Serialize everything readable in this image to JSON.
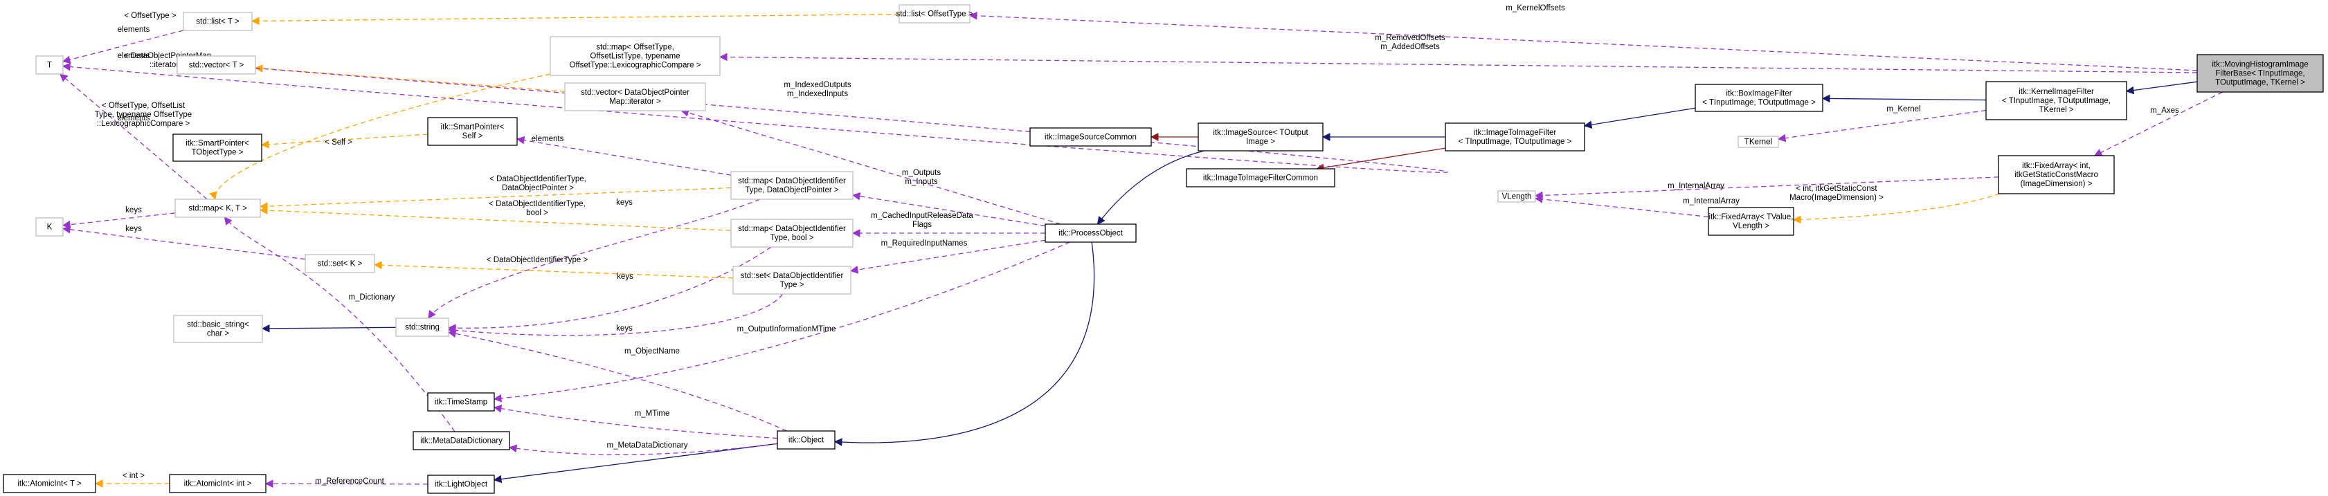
{
  "title": "itk::MovingHistogramImageFilterBase< TInputImage, TOutputImage, TKernel > collaboration diagram",
  "colors": {
    "inheritance": "#191970",
    "protected_inheritance": "#8b1a1a",
    "usage": "#9a32cd",
    "template_instance": "#ffa500",
    "focus_fill": "#bfbfbf"
  },
  "nodes": [
    {
      "id": "MovingHistogramImageFilterBase",
      "lines": [
        "itk::MovingHistogramImage",
        "FilterBase< TInputImage,",
        " TOutputImage, TKernel >"
      ],
      "style": "focus"
    },
    {
      "id": "KernelImageFilter",
      "lines": [
        "itk::KernelImageFilter",
        "< TInputImage, TOutputImage,",
        "TKernel >"
      ],
      "style": "doc"
    },
    {
      "id": "BoxImageFilter",
      "lines": [
        "itk::BoxImageFilter",
        "< TInputImage, TOutputImage >"
      ],
      "style": "doc"
    },
    {
      "id": "ImageToImageFilter",
      "lines": [
        "itk::ImageToImageFilter",
        "< TInputImage, TOutputImage >"
      ],
      "style": "doc"
    },
    {
      "id": "ImageSource",
      "lines": [
        "itk::ImageSource< TOutput",
        "Image >"
      ],
      "style": "doc"
    },
    {
      "id": "ImageSourceCommon",
      "lines": [
        "itk::ImageSourceCommon"
      ],
      "style": "doc"
    },
    {
      "id": "ImageToImageFilterCommon",
      "lines": [
        "itk::ImageToImageFilterCommon"
      ],
      "style": "doc"
    },
    {
      "id": "ProcessObject",
      "lines": [
        "itk::ProcessObject"
      ],
      "style": "doc"
    },
    {
      "id": "Object",
      "lines": [
        "itk::Object"
      ],
      "style": "doc"
    },
    {
      "id": "LightObject",
      "lines": [
        "itk::LightObject"
      ],
      "style": "doc"
    },
    {
      "id": "AtomicIntInt",
      "lines": [
        "itk::AtomicInt< int >"
      ],
      "style": "doc"
    },
    {
      "id": "AtomicIntT",
      "lines": [
        "itk::AtomicInt< T >"
      ],
      "style": "doc"
    },
    {
      "id": "MetaDataDictionary",
      "lines": [
        "itk::MetaDataDictionary"
      ],
      "style": "doc"
    },
    {
      "id": "TimeStamp",
      "lines": [
        "itk::TimeStamp"
      ],
      "style": "doc"
    },
    {
      "id": "StdString",
      "lines": [
        "std::string"
      ],
      "style": "nodoc"
    },
    {
      "id": "BasicString",
      "lines": [
        "std::basic_string<",
        "char >"
      ],
      "style": "nodoc"
    },
    {
      "id": "StdSetK",
      "lines": [
        "std::set< K >"
      ],
      "style": "nodoc"
    },
    {
      "id": "StdMapKT",
      "lines": [
        "std::map< K, T >"
      ],
      "style": "nodoc"
    },
    {
      "id": "K",
      "lines": [
        "K"
      ],
      "style": "nodoc"
    },
    {
      "id": "T",
      "lines": [
        "T"
      ],
      "style": "nodoc"
    },
    {
      "id": "StdListT",
      "lines": [
        "std::list< T >"
      ],
      "style": "nodoc"
    },
    {
      "id": "StdVectorT",
      "lines": [
        "std::vector< T >"
      ],
      "style": "nodoc"
    },
    {
      "id": "SmartPointerTObjectType",
      "lines": [
        "itk::SmartPointer<",
        "TObjectType >"
      ],
      "style": "doc"
    },
    {
      "id": "SmartPointerSelf",
      "lines": [
        "itk::SmartPointer<",
        "Self >"
      ],
      "style": "doc"
    },
    {
      "id": "MapOffsetType",
      "lines": [
        "std::map< OffsetType,",
        " OffsetListType, typename",
        " OffsetType::LexicographicCompare >"
      ],
      "style": "nodoc"
    },
    {
      "id": "VectorDOPMapIter",
      "lines": [
        "std::vector< DataObjectPointer",
        "Map::iterator >"
      ],
      "style": "nodoc"
    },
    {
      "id": "ListOffsetType",
      "lines": [
        "std::list< OffsetType >"
      ],
      "style": "nodoc"
    },
    {
      "id": "MapDOIdDOPtr",
      "lines": [
        "std::map< DataObjectIdentifier",
        "Type, DataObjectPointer >"
      ],
      "style": "nodoc"
    },
    {
      "id": "MapDOIdBool",
      "lines": [
        "std::map< DataObjectIdentifier",
        "Type, bool >"
      ],
      "style": "nodoc"
    },
    {
      "id": "SetDOId",
      "lines": [
        "std::set< DataObjectIdentifier",
        "Type >"
      ],
      "style": "nodoc"
    },
    {
      "id": "TKernel",
      "lines": [
        "TKernel"
      ],
      "style": "nodoc"
    },
    {
      "id": "FixedArrayIntDim",
      "lines": [
        "itk::FixedArray< int,",
        " itkGetStaticConstMacro",
        "(ImageDimension) >"
      ],
      "style": "doc"
    },
    {
      "id": "FixedArrayTValue",
      "lines": [
        "itk::FixedArray< TValue,",
        "VLength >"
      ],
      "style": "doc"
    },
    {
      "id": "VLength",
      "lines": [
        "VLength"
      ],
      "style": "nodoc"
    }
  ],
  "edges": [
    {
      "from": "MovingHistogramImageFilterBase",
      "to": "KernelImageFilter",
      "kind": "inherit",
      "label": []
    },
    {
      "from": "MovingHistogramImageFilterBase",
      "to": "ListOffsetType",
      "kind": "usage",
      "label": [
        "m_KernelOffsets"
      ]
    },
    {
      "from": "MovingHistogramImageFilterBase",
      "to": "MapOffsetType",
      "kind": "usage",
      "label": [
        "m_RemovedOffsets",
        "m_AddedOffsets"
      ]
    },
    {
      "from": "MovingHistogramImageFilterBase",
      "to": "FixedArrayIntDim",
      "kind": "usage",
      "label": [
        "m_Axes"
      ]
    },
    {
      "from": "KernelImageFilter",
      "to": "BoxImageFilter",
      "kind": "inherit",
      "label": []
    },
    {
      "from": "KernelImageFilter",
      "to": "TKernel",
      "kind": "usage",
      "label": [
        "m_Kernel"
      ]
    },
    {
      "from": "BoxImageFilter",
      "to": "ImageToImageFilter",
      "kind": "inherit",
      "label": []
    },
    {
      "from": "ImageToImageFilter",
      "to": "ImageSource",
      "kind": "inherit",
      "label": []
    },
    {
      "from": "ImageToImageFilter",
      "to": "ImageToImageFilterCommon",
      "kind": "inherit-prot",
      "label": []
    },
    {
      "from": "ImageSource",
      "to": "ImageSourceCommon",
      "kind": "inherit-prot",
      "label": []
    },
    {
      "from": "ImageSource",
      "to": "ProcessObject",
      "kind": "inherit",
      "label": []
    },
    {
      "from": "ProcessObject",
      "to": "Object",
      "kind": "inherit",
      "label": []
    },
    {
      "from": "ProcessObject",
      "to": "VectorDOPMapIter",
      "kind": "usage",
      "label": [
        "m_IndexedOutputs",
        "m_IndexedInputs"
      ]
    },
    {
      "from": "ProcessObject",
      "to": "MapDOIdDOPtr",
      "kind": "usage",
      "label": [
        "m_Outputs",
        "m_Inputs"
      ]
    },
    {
      "from": "ProcessObject",
      "to": "MapDOIdBool",
      "kind": "usage",
      "label": [
        "m_CachedInputReleaseData",
        "Flags"
      ]
    },
    {
      "from": "ProcessObject",
      "to": "SetDOId",
      "kind": "usage",
      "label": [
        "m_RequiredInputNames"
      ]
    },
    {
      "from": "ProcessObject",
      "to": "TimeStamp",
      "kind": "usage",
      "label": [
        "m_OutputInformationMTime"
      ]
    },
    {
      "from": "Object",
      "to": "LightObject",
      "kind": "inherit",
      "label": []
    },
    {
      "from": "Object",
      "to": "StdString",
      "kind": "usage",
      "label": [
        "m_ObjectName"
      ]
    },
    {
      "from": "Object",
      "to": "TimeStamp",
      "kind": "usage",
      "label": [
        "m_MTime"
      ]
    },
    {
      "from": "Object",
      "to": "MetaDataDictionary",
      "kind": "usage",
      "label": [
        "m_MetaDataDictionary"
      ]
    },
    {
      "from": "LightObject",
      "to": "AtomicIntInt",
      "kind": "usage",
      "label": [
        "m_ReferenceCount"
      ]
    },
    {
      "from": "AtomicIntInt",
      "to": "AtomicIntT",
      "kind": "template",
      "label": [
        "< int >"
      ]
    },
    {
      "from": "MetaDataDictionary",
      "to": "StdMapKT",
      "kind": "usage",
      "label": [
        "m_Dictionary"
      ]
    },
    {
      "from": "StdString",
      "to": "BasicString",
      "kind": "inherit",
      "label": []
    },
    {
      "from": "MapDOIdDOPtr",
      "to": "StdString",
      "kind": "usage",
      "label": [
        "keys"
      ]
    },
    {
      "from": "MapDOIdBool",
      "to": "StdString",
      "kind": "usage",
      "label": [
        "keys"
      ]
    },
    {
      "from": "SetDOId",
      "to": "StdString",
      "kind": "usage",
      "label": [
        "keys"
      ]
    },
    {
      "from": "MapDOIdDOPtr",
      "to": "StdMapKT",
      "kind": "template",
      "label": [
        "< DataObjectIdentifierType,",
        "DataObjectPointer >"
      ]
    },
    {
      "from": "MapDOIdBool",
      "to": "StdMapKT",
      "kind": "template",
      "label": [
        "< DataObjectIdentifierType,",
        "bool >"
      ]
    },
    {
      "from": "SetDOId",
      "to": "StdSetK",
      "kind": "template",
      "label": [
        "< DataObjectIdentifierType >"
      ]
    },
    {
      "from": "MapOffsetType",
      "to": "StdMapKT",
      "kind": "template",
      "label": [
        "< OffsetType, OffsetList",
        "Type, typename OffsetType",
        "::LexicographicCompare >"
      ]
    },
    {
      "from": "VectorDOPMapIter",
      "to": "StdVectorT",
      "kind": "template",
      "label": [
        "< DataObjectPointerMap",
        "::iterator >"
      ]
    },
    {
      "from": "ListOffsetType",
      "to": "StdListT",
      "kind": "template",
      "label": [
        "< OffsetType >"
      ]
    },
    {
      "from": "SmartPointerSelf",
      "to": "SmartPointerTObjectType",
      "kind": "template",
      "label": [
        "< Self >"
      ]
    },
    {
      "from": "MapDOIdDOPtr",
      "to": "SmartPointerSelf",
      "kind": "usage",
      "label": [
        "elements"
      ]
    },
    {
      "from": "StdMapKT",
      "to": "K",
      "kind": "usage",
      "label": [
        "keys"
      ]
    },
    {
      "from": "StdSetK",
      "to": "K",
      "kind": "usage",
      "label": [
        "keys"
      ]
    },
    {
      "from": "StdMapKT",
      "to": "T",
      "kind": "usage",
      "label": [
        "elements"
      ]
    },
    {
      "from": "StdListT",
      "to": "T",
      "kind": "usage",
      "label": [
        "elements"
      ]
    },
    {
      "from": "StdVectorT",
      "to": "T",
      "kind": "usage",
      "label": [
        "elements"
      ]
    },
    {
      "from": "FixedArrayIntDim",
      "to": "VLength",
      "kind": "usage",
      "label": [
        "m_InternalArray"
      ]
    },
    {
      "from": "FixedArrayTValue",
      "to": "VLength",
      "kind": "usage",
      "label": [
        "m_InternalArray"
      ]
    },
    {
      "from": "FixedArrayIntDim",
      "to": "FixedArrayTValue",
      "kind": "template",
      "label": [
        "< int, itkGetStaticConst",
        "Macro(ImageDimension) >"
      ]
    }
  ]
}
